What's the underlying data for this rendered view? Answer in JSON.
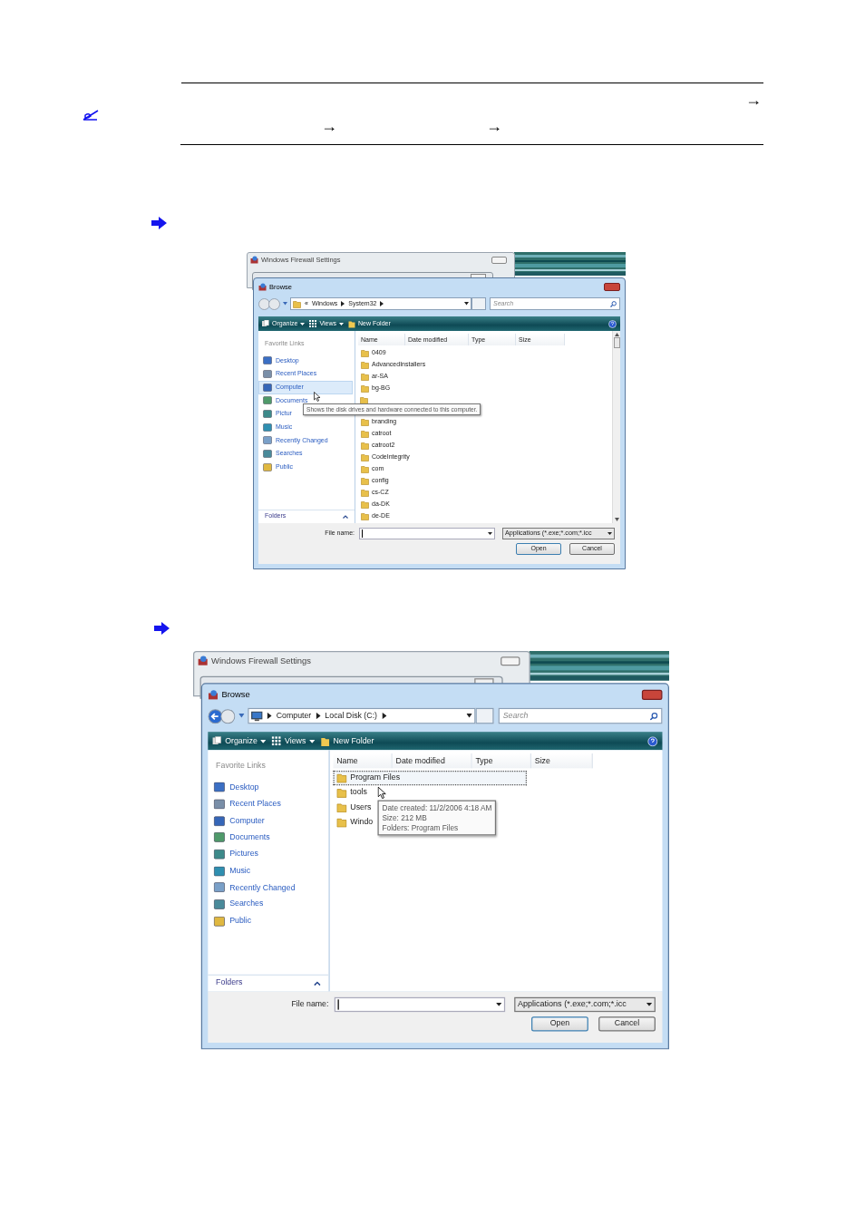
{
  "header_arrows": [
    "→",
    "→",
    "→"
  ],
  "screenshots": [
    {
      "background_title": "Windows Firewall Settings",
      "title": "Browse",
      "back_enabled": false,
      "location": {
        "kind": "folder",
        "overflow": "«",
        "path": [
          "Windows",
          "System32"
        ]
      },
      "search": "Search",
      "toolbar": [
        "Organize",
        "Views",
        "New Folder"
      ],
      "links_title": "Favorite Links",
      "links": [
        {
          "label": "Desktop",
          "selected": false
        },
        {
          "label": "Recent Places",
          "selected": false
        },
        {
          "label": "Computer",
          "selected": true
        },
        {
          "label": "Documents",
          "selected": false
        },
        {
          "label": "Pictur",
          "selected": false
        },
        {
          "label": "Music",
          "selected": false
        },
        {
          "label": "Recently Changed",
          "selected": false
        },
        {
          "label": "Searches",
          "selected": false
        },
        {
          "label": "Public",
          "selected": false
        }
      ],
      "columns": [
        "Name",
        "Date modified",
        "Type",
        "Size"
      ],
      "files": [
        {
          "kind": "folder",
          "name": "0409",
          "selected": false
        },
        {
          "kind": "folder",
          "name": "AdvancedInstallers",
          "selected": false
        },
        {
          "kind": "folder",
          "name": "ar-SA",
          "selected": false
        },
        {
          "kind": "folder",
          "name": "bg-BG",
          "selected": false
        },
        {
          "kind": "covered"
        },
        {
          "kind": "folder",
          "name": "branding",
          "selected": false
        },
        {
          "kind": "folder",
          "name": "catroot",
          "selected": false
        },
        {
          "kind": "folder",
          "name": "catroot2",
          "selected": false
        },
        {
          "kind": "folder",
          "name": "CodeIntegrity",
          "selected": false
        },
        {
          "kind": "folder",
          "name": "com",
          "selected": false
        },
        {
          "kind": "folder",
          "name": "config",
          "selected": false
        },
        {
          "kind": "folder",
          "name": "cs-CZ",
          "selected": false
        },
        {
          "kind": "folder",
          "name": "da-DK",
          "selected": false
        },
        {
          "kind": "folder",
          "name": "de-DE",
          "selected": false
        }
      ],
      "tooltip": [
        "Shows the disk drives and hardware connected to this computer."
      ],
      "scrollbar": true,
      "folders": "Folders",
      "file_name_label": "File name:",
      "filter": "Applications (*.exe;*.com;*.icc",
      "buttons": [
        "Open",
        "Cancel"
      ]
    },
    {
      "background_title": "Windows Firewall Settings",
      "title": "Browse",
      "back_enabled": true,
      "location": {
        "kind": "computer",
        "path": [
          "Computer",
          "Local Disk (C:)"
        ]
      },
      "search": "Search",
      "toolbar": [
        "Organize",
        "Views",
        "New Folder"
      ],
      "links_title": "Favorite Links",
      "links": [
        {
          "label": "Desktop",
          "selected": false
        },
        {
          "label": "Recent Places",
          "selected": false
        },
        {
          "label": "Computer",
          "selected": false
        },
        {
          "label": "Documents",
          "selected": false
        },
        {
          "label": "Pictures",
          "selected": false
        },
        {
          "label": "Music",
          "selected": false
        },
        {
          "label": "Recently Changed",
          "selected": false
        },
        {
          "label": "Searches",
          "selected": false
        },
        {
          "label": "Public",
          "selected": false
        }
      ],
      "columns": [
        "Name",
        "Date modified",
        "Type",
        "Size"
      ],
      "files": [
        {
          "kind": "folder",
          "name": "Program Files",
          "selected": true
        },
        {
          "kind": "folder",
          "name": "tools",
          "selected": false
        },
        {
          "kind": "folder",
          "name": "Users",
          "selected": false
        },
        {
          "kind": "folder",
          "name": "Windo",
          "selected": false
        }
      ],
      "tooltip": [
        "Date created: 11/2/2006 4:18 AM",
        "Size: 212 MB",
        "Folders: Program Files"
      ],
      "folders": "Folders",
      "file_name_label": "File name:",
      "filter": "Applications (*.exe;*.com;*.icc",
      "buttons": [
        "Open",
        "Cancel"
      ]
    }
  ]
}
